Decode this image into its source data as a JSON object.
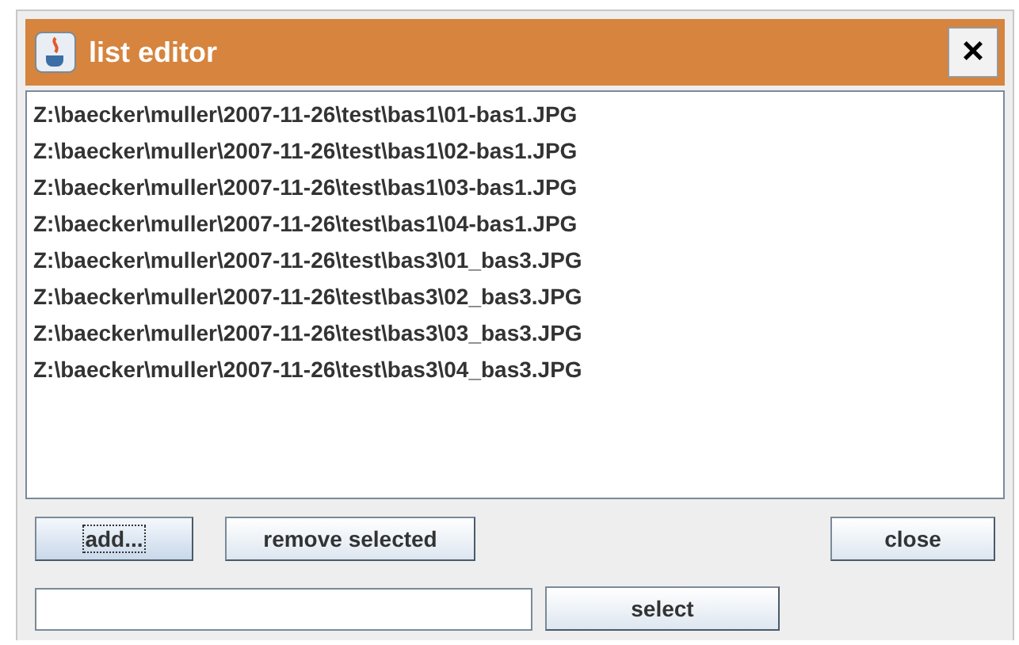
{
  "window": {
    "title": "list editor",
    "close": "×"
  },
  "list": {
    "items": [
      "Z:\\baecker\\muller\\2007-11-26\\test\\bas1\\01-bas1.JPG",
      "Z:\\baecker\\muller\\2007-11-26\\test\\bas1\\02-bas1.JPG",
      "Z:\\baecker\\muller\\2007-11-26\\test\\bas1\\03-bas1.JPG",
      "Z:\\baecker\\muller\\2007-11-26\\test\\bas1\\04-bas1.JPG",
      "Z:\\baecker\\muller\\2007-11-26\\test\\bas3\\01_bas3.JPG",
      "Z:\\baecker\\muller\\2007-11-26\\test\\bas3\\02_bas3.JPG",
      "Z:\\baecker\\muller\\2007-11-26\\test\\bas3\\03_bas3.JPG",
      "Z:\\baecker\\muller\\2007-11-26\\test\\bas3\\04_bas3.JPG"
    ]
  },
  "buttons": [
    {
      "label": "add...",
      "focused": true
    },
    {
      "label": "remove selected",
      "focused": false
    },
    {
      "label": "close",
      "focused": false
    }
  ],
  "select_button": {
    "label": "select"
  }
}
